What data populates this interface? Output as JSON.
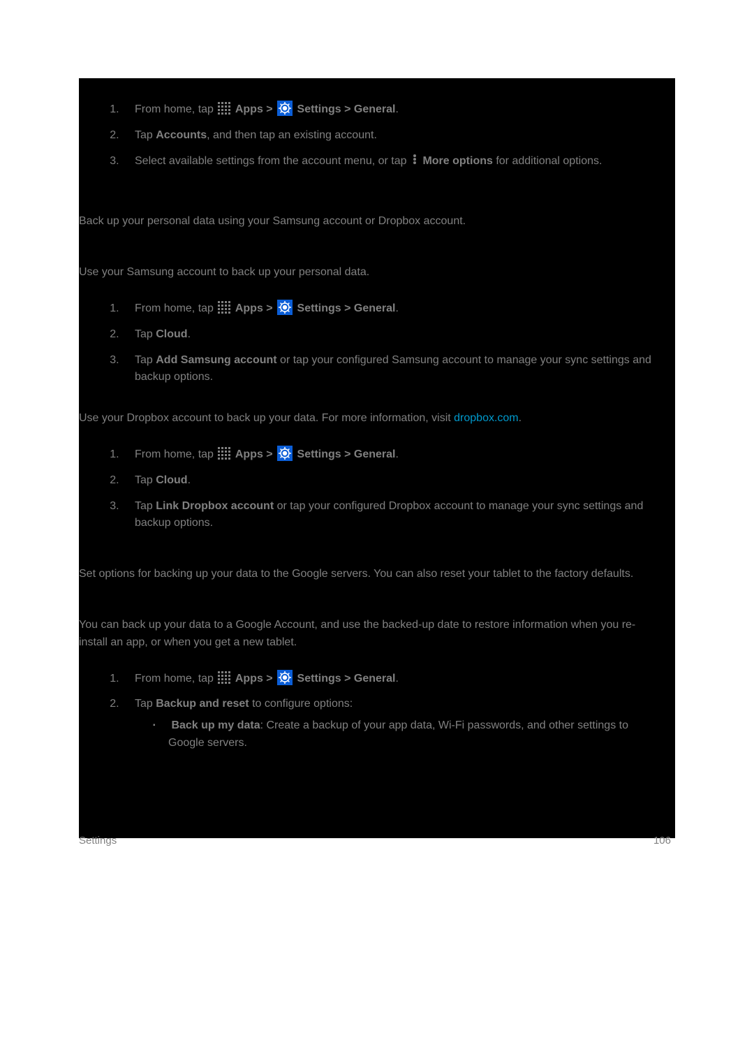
{
  "nav": {
    "from_home_tap": "From home, tap",
    "apps": "Apps >",
    "settings_general": "Settings > General"
  },
  "sec1": {
    "s2_a": "Tap ",
    "s2_b": "Accounts",
    "s2_c": ", and then tap an existing account.",
    "s3_a": "Select available settings from the account menu, or tap",
    "s3_b": "More options",
    "s3_c": " for additional options."
  },
  "sec2": {
    "intro": "Back up your personal data using your Samsung account or Dropbox account."
  },
  "sec3": {
    "intro": "Use your Samsung account to back up your personal data.",
    "s2_a": "Tap ",
    "s2_b": "Cloud",
    "s2_c": ".",
    "s3_a": "Tap ",
    "s3_b": "Add Samsung account",
    "s3_c": " or tap your configured Samsung account to manage your sync settings and backup options."
  },
  "sec4": {
    "intro_a": "Use your Dropbox account to back up your data. For more information, visit ",
    "intro_link": "dropbox.com",
    "intro_b": ".",
    "s2_a": "Tap ",
    "s2_b": "Cloud",
    "s2_c": ".",
    "s3_a": "Tap ",
    "s3_b": "Link Dropbox account",
    "s3_c": " or tap your configured Dropbox account to manage your sync settings and backup options."
  },
  "sec5": {
    "intro": "Set options for backing up your data to the Google servers. You can also reset your tablet to the factory defaults."
  },
  "sec6": {
    "intro": "You can back up your data to a Google Account, and use the backed-up date to restore information when you re-install an app, or when you get a new tablet.",
    "s2_a": "Tap ",
    "s2_b": "Backup and reset",
    "s2_c": " to configure options:",
    "b1_a": "Back up my data",
    "b1_b": ": Create a backup of your app data, Wi-Fi passwords, and other settings to Google servers."
  },
  "footer": {
    "left": "Settings",
    "right": "106"
  },
  "period": "."
}
